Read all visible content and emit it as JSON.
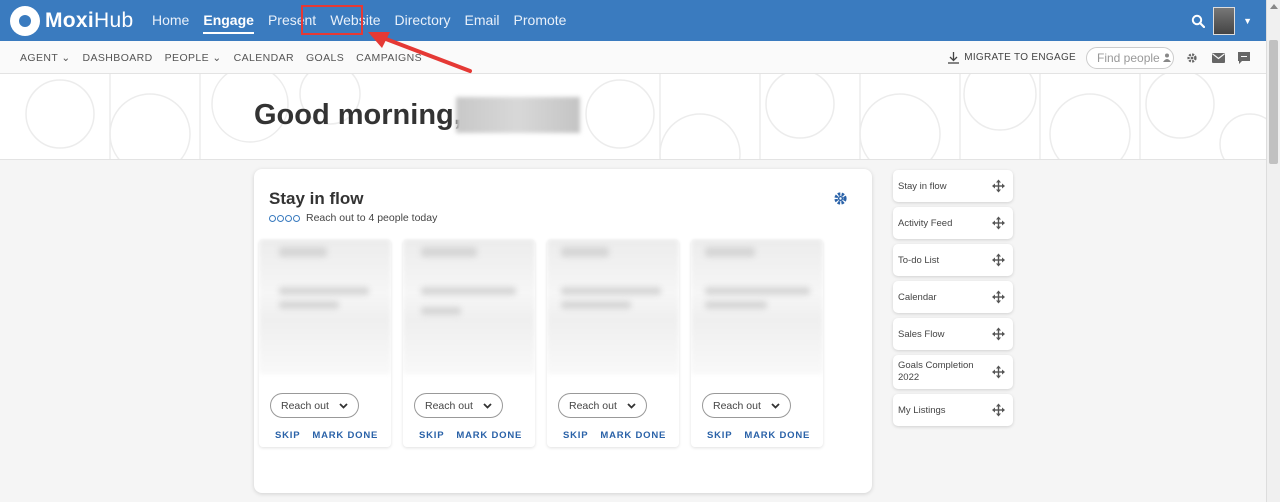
{
  "colors": {
    "brand": "#3a7bbf",
    "link": "#2a62a8",
    "annotation": "#e53935"
  },
  "topnav": {
    "logo": {
      "prefix": "Moxi",
      "suffix": "Hub"
    },
    "links": [
      "Home",
      "Engage",
      "Present",
      "Website",
      "Directory",
      "Email",
      "Promote"
    ],
    "active": "Engage",
    "highlighted": "Website"
  },
  "subnav": {
    "links": [
      "AGENT",
      "DASHBOARD",
      "PEOPLE",
      "CALENDAR",
      "GOALS",
      "CAMPAIGNS"
    ],
    "migrate_label": "MIGRATE TO ENGAGE",
    "find_placeholder": "Find people"
  },
  "hero": {
    "greeting": "Good morning,"
  },
  "stay_in_flow": {
    "title": "Stay in flow",
    "subtitle": "Reach out to 4 people today",
    "cards": [
      {
        "reach_label": "Reach out",
        "skip_label": "SKIP",
        "done_label": "MARK DONE"
      },
      {
        "reach_label": "Reach out",
        "skip_label": "SKIP",
        "done_label": "MARK DONE"
      },
      {
        "reach_label": "Reach out",
        "skip_label": "SKIP",
        "done_label": "MARK DONE"
      },
      {
        "reach_label": "Reach out",
        "skip_label": "SKIP",
        "done_label": "MARK DONE"
      }
    ]
  },
  "widgets": [
    "Stay in flow",
    "Activity Feed",
    "To-do List",
    "Calendar",
    "Sales Flow",
    "Goals Completion 2022",
    "My Listings"
  ]
}
